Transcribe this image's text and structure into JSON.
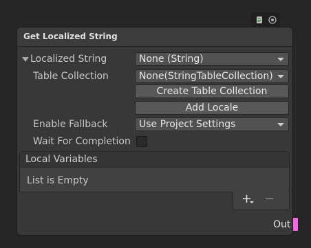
{
  "node": {
    "title": "Get Localized String",
    "localized_string": {
      "label": "Localized String",
      "value": "None (String)",
      "expanded": true
    },
    "table_collection": {
      "label": "Table Collection",
      "value": "None(StringTableCollection)"
    },
    "buttons": {
      "create_table_collection": "Create Table Collection",
      "add_locale": "Add Locale"
    },
    "enable_fallback": {
      "label": "Enable Fallback",
      "value": "Use Project Settings"
    },
    "wait_for_completion": {
      "label": "Wait For Completion",
      "checked": false
    },
    "local_variables": {
      "header": "Local Variables",
      "empty_text": "List is Empty",
      "add_symbol": "+",
      "remove_symbol": "−"
    },
    "output": {
      "label": "Out",
      "port_color": "#e96ddd"
    }
  },
  "icons": {
    "top_left": "document-icon",
    "top_right": "settings-circle-icon"
  },
  "colors": {
    "background": "#262626",
    "node_body": "#383838",
    "field": "#515151",
    "button": "#585858",
    "text": "#e6e6e6"
  }
}
